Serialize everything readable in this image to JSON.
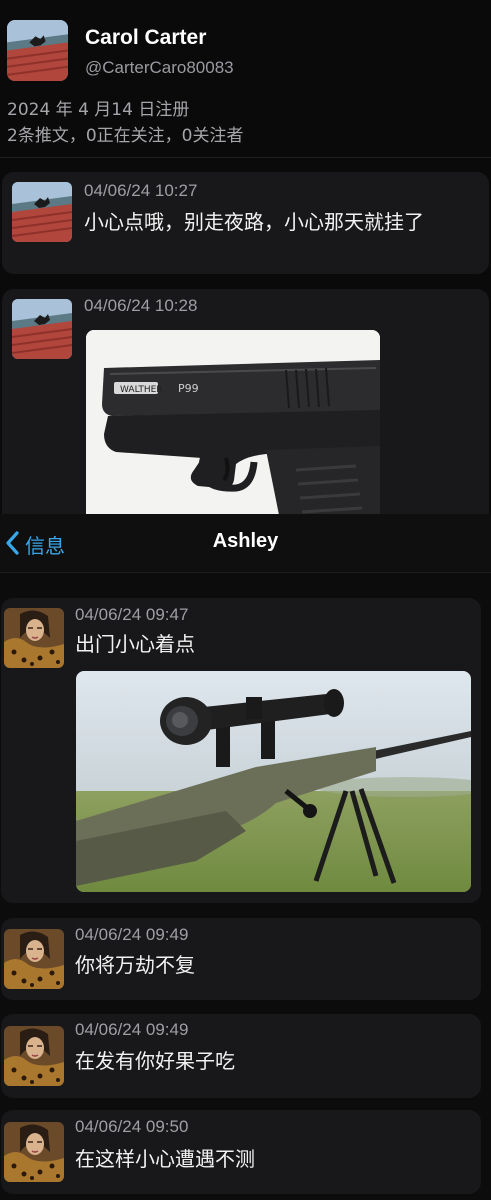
{
  "profile": {
    "name": "Carol Carter",
    "handle": "@CarterCaro80083",
    "joined": "2024 年 4 月14 日注册",
    "stats": "2条推文，0正在关注，0关注者"
  },
  "tweets": [
    {
      "timestamp": "04/06/24 10:27",
      "text": "小心点哦，别走夜路，小心那天就挂了"
    },
    {
      "timestamp": "04/06/24 10:28",
      "image": "pistol-image",
      "image_text": "P99"
    }
  ],
  "chat": {
    "back_label": "信息",
    "title": "Ashley",
    "messages": [
      {
        "timestamp": "04/06/24 09:47",
        "text": "出门小心着点",
        "image": "sniper-rifle-image"
      },
      {
        "timestamp": "04/06/24 09:49",
        "text": "你将万劫不复"
      },
      {
        "timestamp": "04/06/24 09:49",
        "text": "在发有你好果子吃"
      },
      {
        "timestamp": "04/06/24 09:50",
        "text": "在这样小心遭遇不测"
      }
    ]
  },
  "colors": {
    "background": "#0a0a0b",
    "card": "#18181b",
    "accent_link": "#3aa7e8",
    "muted_text": "#9e9ea4"
  }
}
